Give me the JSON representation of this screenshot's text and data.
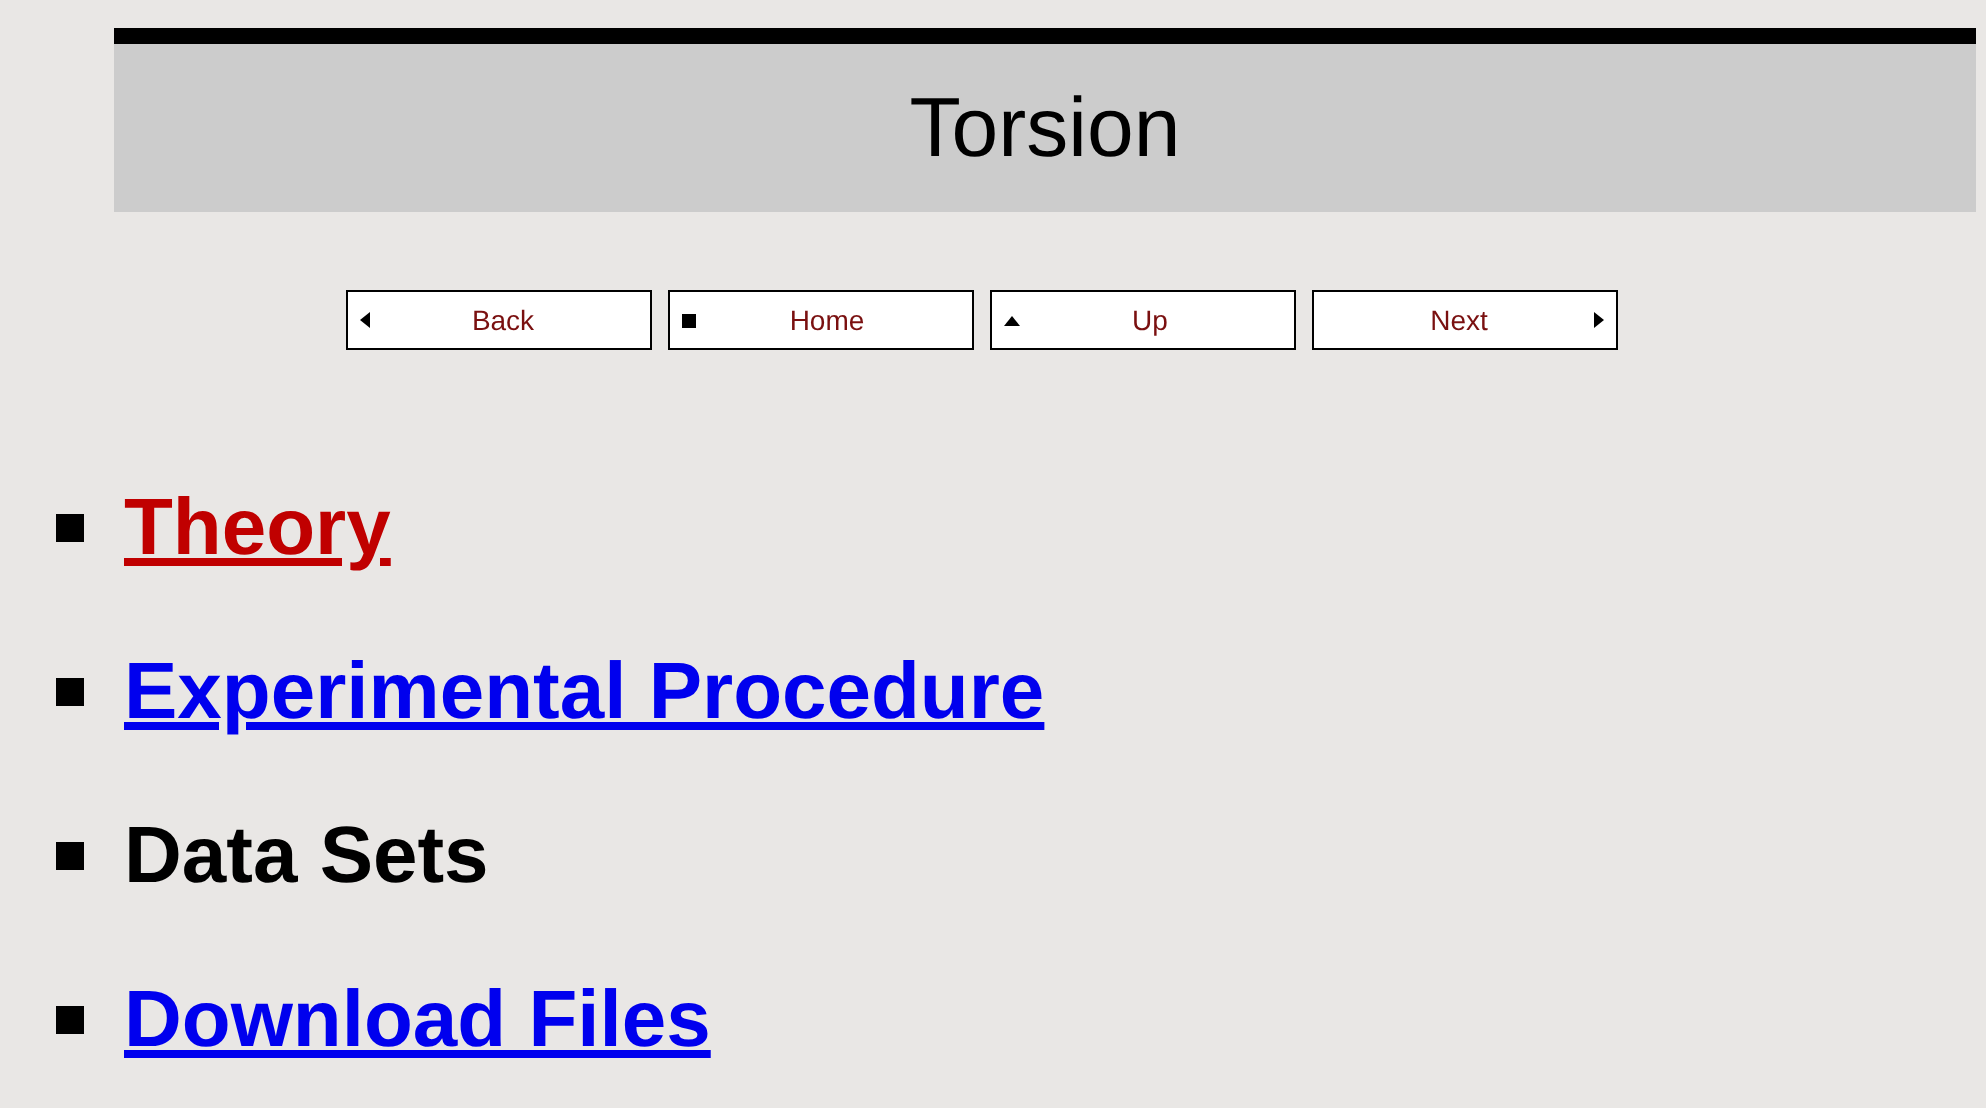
{
  "header": {
    "title": "Torsion"
  },
  "nav_buttons": [
    {
      "label": "Back",
      "kind": "back"
    },
    {
      "label": "Home",
      "kind": "home"
    },
    {
      "label": "Up",
      "kind": "up"
    },
    {
      "label": "Next",
      "kind": "next"
    }
  ],
  "items": [
    {
      "label": "Theory",
      "kind": "link",
      "visited": true
    },
    {
      "label": "Experimental Procedure",
      "kind": "link",
      "visited": false
    },
    {
      "label": "Data Sets",
      "kind": "text"
    },
    {
      "label": "Download Files",
      "kind": "link",
      "visited": false
    }
  ]
}
